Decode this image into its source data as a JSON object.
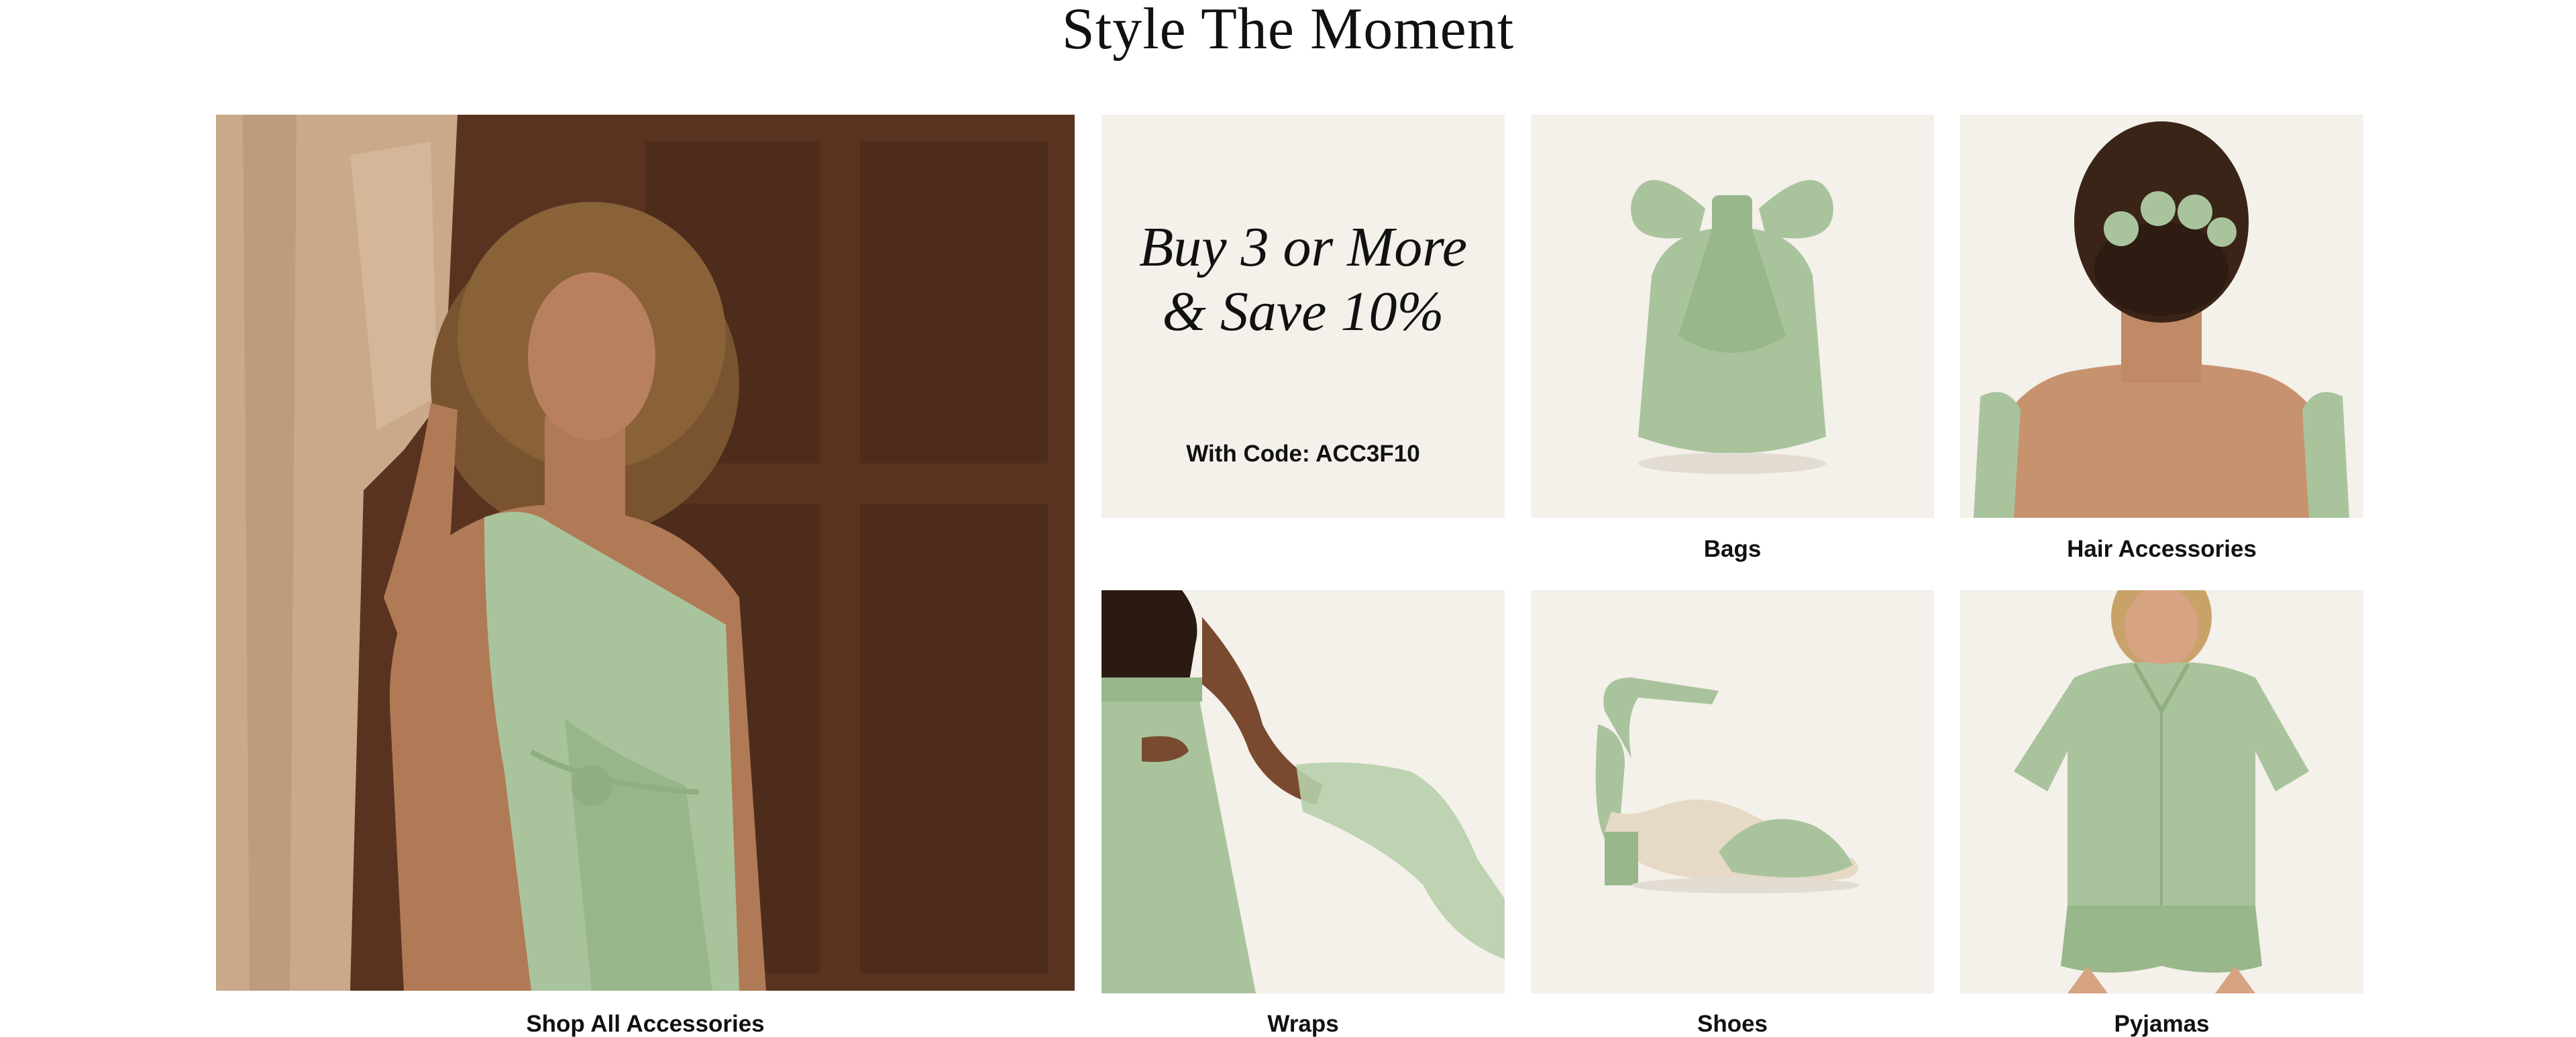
{
  "section": {
    "title": "Style The Moment"
  },
  "hero": {
    "caption": "Shop All Accessories"
  },
  "promo": {
    "headline_line1": "Buy 3 or More",
    "headline_line2": "& Save 10%",
    "code_text": "With Code: ACC3F10"
  },
  "categories": [
    {
      "label": "Bags"
    },
    {
      "label": "Hair Accessories"
    },
    {
      "label": "Wraps"
    },
    {
      "label": "Shoes"
    },
    {
      "label": "Pyjamas"
    }
  ],
  "colors": {
    "sage": "#a9c49c",
    "sage_dark": "#8fae82",
    "tile_bg": "#f4f0ea",
    "wood": "#4a2a1a",
    "text": "#111111"
  }
}
